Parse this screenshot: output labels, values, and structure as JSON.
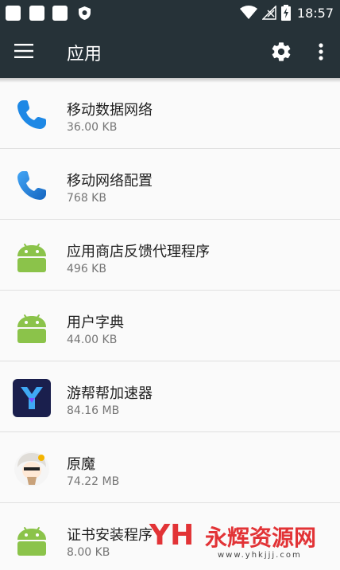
{
  "status_bar": {
    "time": "18:57",
    "icons": [
      "notification-icon",
      "notification-icon",
      "notification-icon",
      "shield-icon",
      "wifi-icon",
      "no-signal-icon",
      "battery-charging-icon"
    ]
  },
  "toolbar": {
    "title": "应用",
    "menu_icon": "menu-icon",
    "settings_icon": "gear-icon",
    "more_icon": "more-vert-icon"
  },
  "apps": [
    {
      "name": "移动数据网络",
      "size": "36.00 KB",
      "icon": "phone-icon"
    },
    {
      "name": "移动网络配置",
      "size": "768 KB",
      "icon": "phone-icon"
    },
    {
      "name": "应用商店反馈代理程序",
      "size": "496 KB",
      "icon": "android-icon"
    },
    {
      "name": "用户字典",
      "size": "44.00 KB",
      "icon": "android-icon"
    },
    {
      "name": "游帮帮加速器",
      "size": "84.16 MB",
      "icon": "app-logo-icon"
    },
    {
      "name": "原魔",
      "size": "74.22 MB",
      "icon": "anime-avatar-icon"
    },
    {
      "name": "证书安装程序",
      "size": "8.00 KB",
      "icon": "android-icon"
    }
  ],
  "watermark": {
    "logo": "YH",
    "text": "永辉资源网",
    "url": "www.yhkjjj.com"
  },
  "colors": {
    "toolbar": "#263238",
    "list_bg": "#fafafa",
    "phone_blue": "#1e88e5",
    "android_green": "#8bc34a",
    "watermark_red": "#e23336"
  }
}
